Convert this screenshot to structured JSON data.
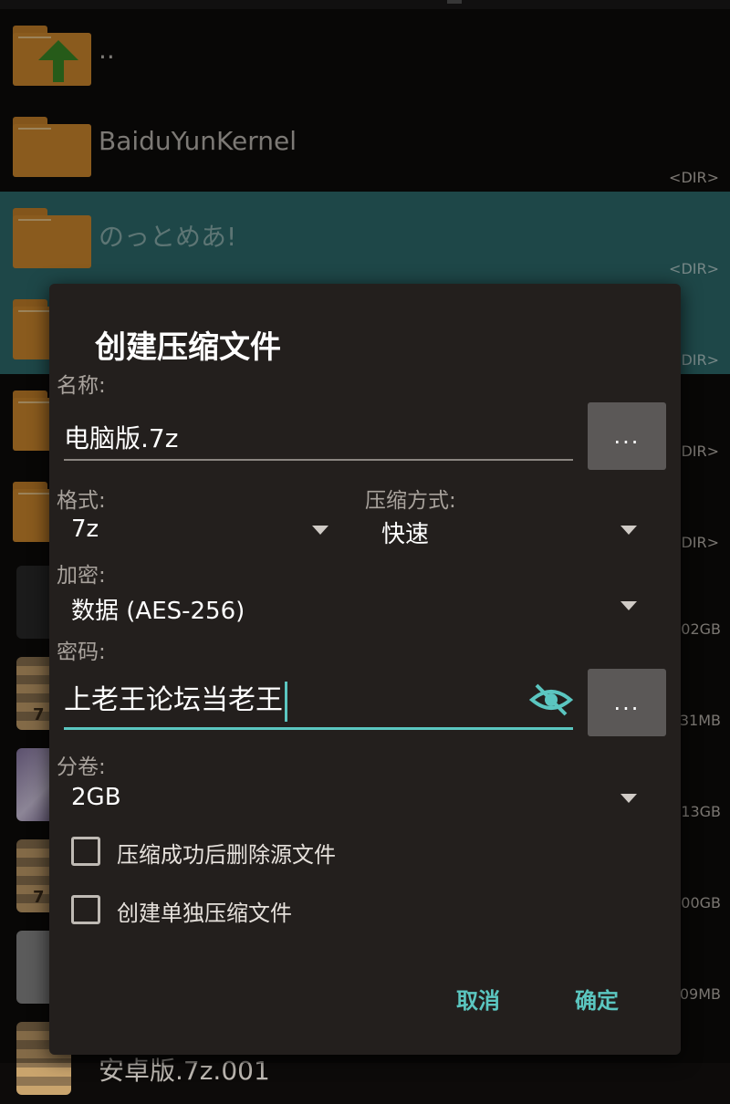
{
  "list": {
    "rows": [
      {
        "name": "..",
        "meta": ""
      },
      {
        "name": "BaiduYunKernel",
        "meta": "<DIR>"
      },
      {
        "name": "のっとめあ!",
        "meta": "<DIR>"
      },
      {
        "name": "",
        "meta": "<DIR>"
      },
      {
        "name": "",
        "meta": "<DIR>"
      },
      {
        "name": "",
        "meta": "<DIR>"
      },
      {
        "name": "",
        "meta": "02GB"
      },
      {
        "name": "",
        "meta": "31MB"
      },
      {
        "name": "",
        "meta": "13GB"
      },
      {
        "name": "",
        "meta": "00GB"
      },
      {
        "name": "",
        "meta": "09MB"
      }
    ],
    "partial_last_name": "安卓版.7z.001"
  },
  "dialog": {
    "title": "创建压缩文件",
    "name_label": "名称:",
    "name_value": "电脑版.7z",
    "browse_label": "...",
    "format_label": "格式:",
    "format_value": "7z",
    "method_label": "压缩方式:",
    "method_value": "快速",
    "encrypt_label": "加密:",
    "encrypt_value": "数据 (AES-256)",
    "password_label": "密码:",
    "password_value": "上老王论坛当老王",
    "password_browse_label": "...",
    "split_label": "分卷:",
    "split_value": "2GB",
    "checkbox_delete": "压缩成功后删除源文件",
    "checkbox_separate": "创建单独压缩文件",
    "cancel": "取消",
    "confirm": "确定"
  },
  "colors": {
    "accent": "#5bc6c0",
    "selected_row": "#2e6e6f",
    "folder": "#d48c2e",
    "dialog_bg": "#231f1d"
  }
}
